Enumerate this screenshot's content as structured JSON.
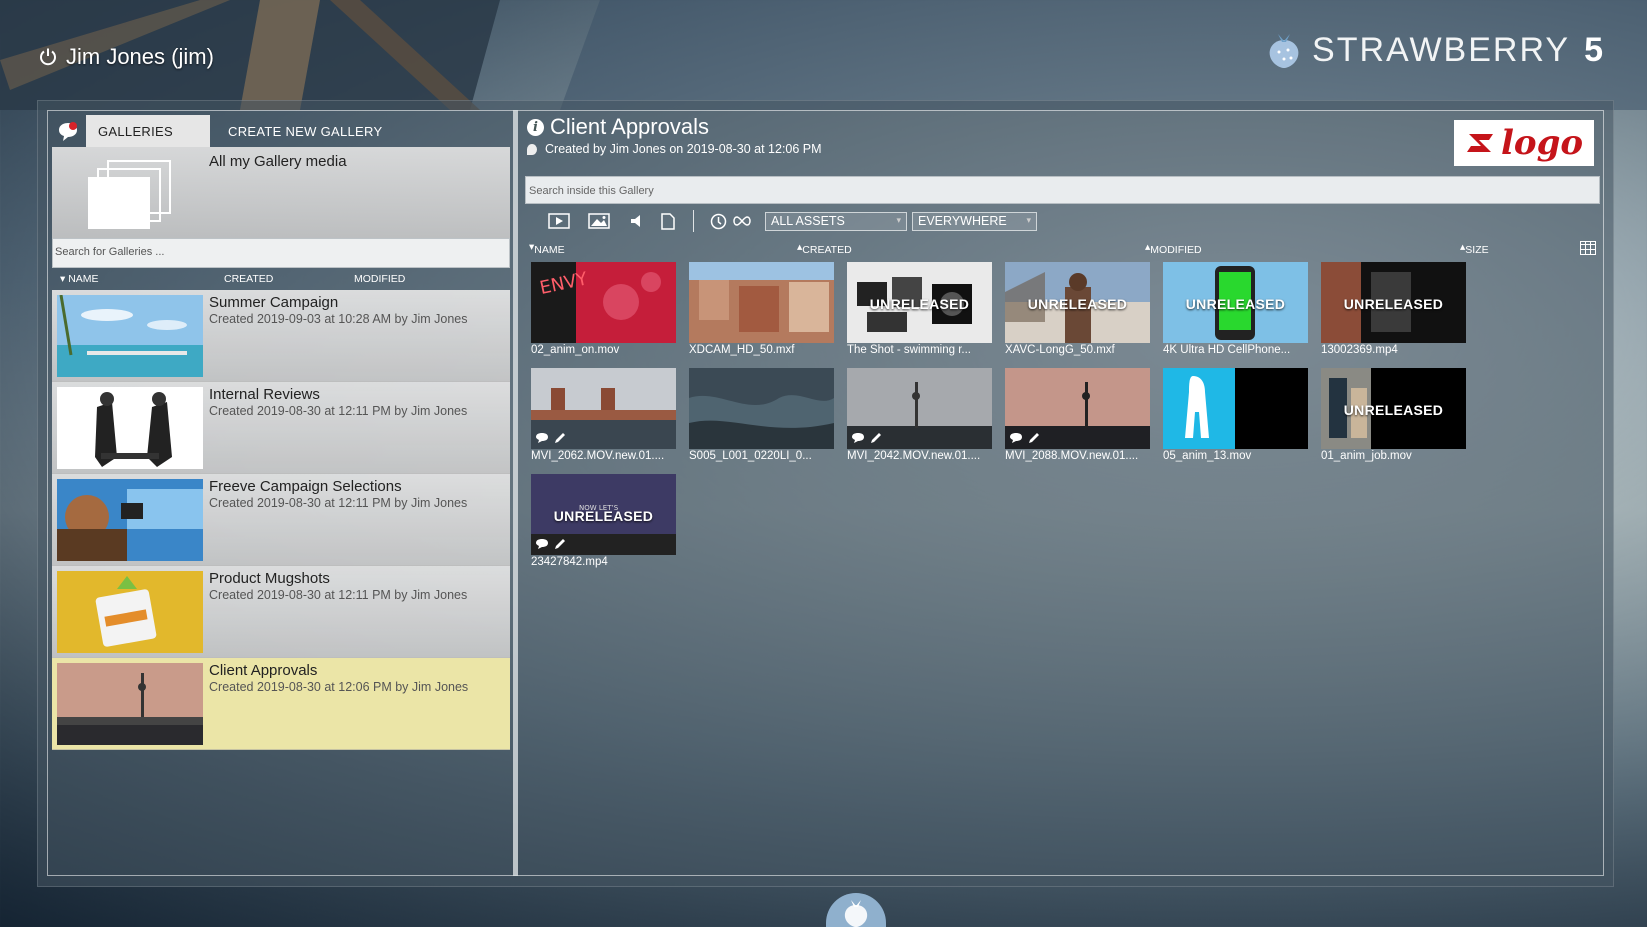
{
  "header": {
    "user_label": "Jim Jones (jim)",
    "brand_word": "STRAWBERRY",
    "brand_version": "5"
  },
  "galleries": {
    "tabs": {
      "galleries": "GALLERIES",
      "create": "CREATE NEW GALLERY"
    },
    "all_media_label": "All my Gallery media",
    "search_placeholder": "Search for Galleries ...",
    "columns": {
      "name": "NAME",
      "created": "CREATED",
      "modified": "MODIFIED"
    },
    "items": [
      {
        "title": "Summer Campaign",
        "subtitle": "Created 2019-09-03 at 10:28 AM by Jim Jones"
      },
      {
        "title": "Internal Reviews",
        "subtitle": "Created 2019-08-30 at 12:11 PM by Jim Jones"
      },
      {
        "title": "Freeve Campaign Selections",
        "subtitle": "Created 2019-08-30 at 12:11 PM by Jim Jones"
      },
      {
        "title": "Product Mugshots",
        "subtitle": "Created 2019-08-30 at 12:11 PM by Jim Jones"
      },
      {
        "title": "Client Approvals",
        "subtitle": "Created 2019-08-30 at 12:06 PM by Jim Jones"
      }
    ],
    "selected_index": 4
  },
  "gallery": {
    "title": "Client Approvals",
    "subtitle": "Created by Jim Jones on 2019-08-30 at 12:06 PM",
    "logo_text": "logo",
    "search_placeholder": "Search inside this Gallery",
    "asset_filter": "ALL ASSETS",
    "scope_filter": "EVERYWHERE",
    "columns": {
      "name": "NAME",
      "created": "CREATED",
      "modified": "MODIFIED",
      "size": "SIZE"
    },
    "unreleased_label": "UNRELEASED",
    "assets": [
      {
        "name": "02_anim_on.mov",
        "unreleased": false,
        "comments": false
      },
      {
        "name": "XDCAM_HD_50.mxf",
        "unreleased": false,
        "comments": false
      },
      {
        "name": "The Shot - swimming r...",
        "unreleased": true,
        "comments": false
      },
      {
        "name": "XAVC-LongG_50.mxf",
        "unreleased": true,
        "comments": false
      },
      {
        "name": "4K Ultra HD CellPhone...",
        "unreleased": true,
        "comments": false
      },
      {
        "name": "13002369.mp4",
        "unreleased": true,
        "comments": false
      },
      {
        "name": "MVI_2062.MOV.new.01....",
        "unreleased": false,
        "comments": true
      },
      {
        "name": "S005_L001_0220LI_0...",
        "unreleased": false,
        "comments": false
      },
      {
        "name": "MVI_2042.MOV.new.01....",
        "unreleased": false,
        "comments": true
      },
      {
        "name": "MVI_2088.MOV.new.01....",
        "unreleased": false,
        "comments": true
      },
      {
        "name": "05_anim_13.mov",
        "unreleased": false,
        "comments": false
      },
      {
        "name": "01_anim_job.mov",
        "unreleased": true,
        "comments": false
      },
      {
        "name": "23427842.mp4",
        "unreleased": true,
        "comments": true
      }
    ]
  },
  "colors": {
    "selected_row": "#ebe5a7",
    "logo_red": "#c5141a"
  }
}
